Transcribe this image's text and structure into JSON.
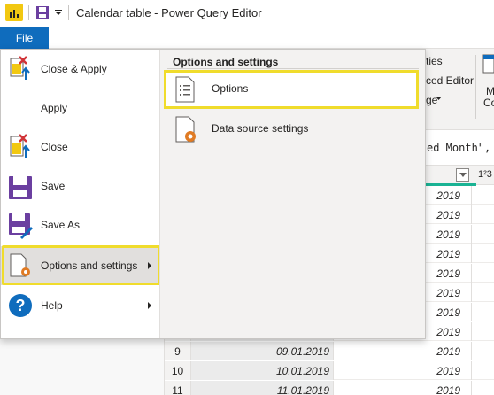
{
  "window": {
    "title": "Calendar table - Power Query Editor"
  },
  "ribbon": {
    "file_tab_label": "File",
    "visible_text_1": "ties",
    "visible_text_2": "ced Editor",
    "visible_text_3": "ge",
    "visible_text_4": "M",
    "visible_text_5": "Co"
  },
  "formula_bar": {
    "visible_text": "ed Month\", \""
  },
  "grid": {
    "type_icon_label": "1²3",
    "rows": [
      {
        "num": "",
        "date": "",
        "year": "2019"
      },
      {
        "num": "",
        "date": "",
        "year": "2019"
      },
      {
        "num": "",
        "date": "",
        "year": "2019"
      },
      {
        "num": "",
        "date": "",
        "year": "2019"
      },
      {
        "num": "",
        "date": "",
        "year": "2019"
      },
      {
        "num": "",
        "date": "",
        "year": "2019"
      },
      {
        "num": "",
        "date": "",
        "year": "2019"
      },
      {
        "num": "",
        "date": "",
        "year": "2019"
      },
      {
        "num": "9",
        "date": "09.01.2019",
        "year": "2019"
      },
      {
        "num": "10",
        "date": "10.01.2019",
        "year": "2019"
      },
      {
        "num": "11",
        "date": "11.01.2019",
        "year": "2019"
      }
    ]
  },
  "file_menu": {
    "items": [
      {
        "label": "Close & Apply",
        "icon": "close-apply-icon"
      },
      {
        "label": "Apply",
        "icon": "apply-icon"
      },
      {
        "label": "Close",
        "icon": "close-doc-icon"
      },
      {
        "label": "Save",
        "icon": "save-icon"
      },
      {
        "label": "Save As",
        "icon": "save-as-icon"
      },
      {
        "label": "Options and settings",
        "icon": "options-settings-icon"
      },
      {
        "label": "Help",
        "icon": "help-icon"
      }
    ],
    "submenu": {
      "title": "Options and settings",
      "items": [
        {
          "label": "Options",
          "icon": "options-list-icon"
        },
        {
          "label": "Data source settings",
          "icon": "data-source-settings-icon"
        }
      ]
    }
  },
  "colors": {
    "accent_blue": "#0f6cbd",
    "highlight_yellow": "#f0dc2c",
    "teal_header": "#1ab394",
    "app_icon_yellow": "#f2c811"
  }
}
